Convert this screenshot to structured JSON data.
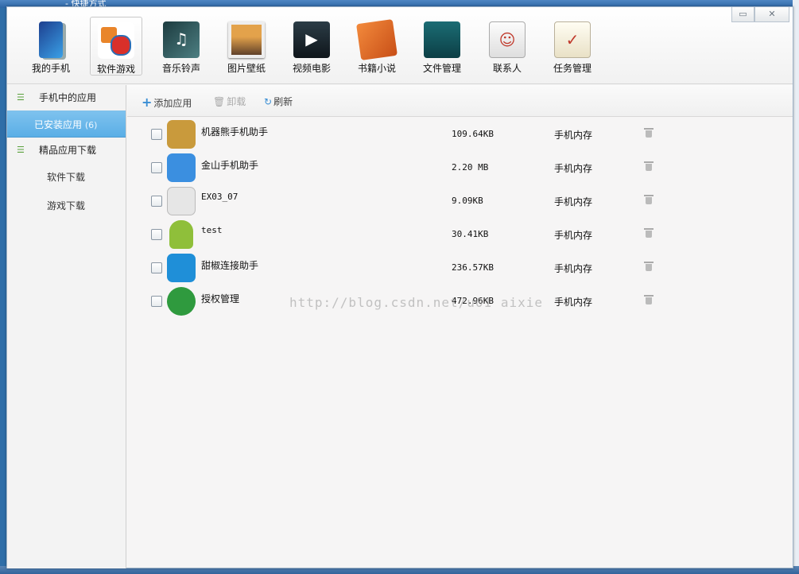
{
  "desktop": {
    "top_label": "- 快捷方式"
  },
  "window": {
    "minimize_glyph": "▭",
    "close_glyph": "✕"
  },
  "nav": [
    {
      "label": "我的手机",
      "icon": "phone-icon"
    },
    {
      "label": "软件游戏",
      "icon": "apps-games-icon",
      "active": true
    },
    {
      "label": "音乐铃声",
      "icon": "music-icon"
    },
    {
      "label": "图片壁纸",
      "icon": "photo-icon"
    },
    {
      "label": "视频电影",
      "icon": "video-icon"
    },
    {
      "label": "书籍小说",
      "icon": "book-icon"
    },
    {
      "label": "文件管理",
      "icon": "folder-icon"
    },
    {
      "label": "联系人",
      "icon": "contacts-icon"
    },
    {
      "label": "任务管理",
      "icon": "task-icon"
    }
  ],
  "sidebar": {
    "group1": "手机中的应用",
    "installed": "已安装应用",
    "installed_count": "(6)",
    "group2": "精品应用下载",
    "software": "软件下载",
    "games": "游戏下载"
  },
  "toolbar": {
    "add": "添加应用",
    "uninstall": "卸载",
    "refresh": "刷新"
  },
  "apps": [
    {
      "name": "机器熊手机助手",
      "size": "109.64KB",
      "location": "手机内存",
      "color": "#c99a3c"
    },
    {
      "name": "金山手机助手",
      "size": "2.20 MB",
      "location": "手机内存",
      "color": "#3b8fe0"
    },
    {
      "name": "EX03_07",
      "size": "9.09KB",
      "location": "手机内存",
      "color": "#e6e6e6"
    },
    {
      "name": "test",
      "size": "30.41KB",
      "location": "手机内存",
      "color": "#8fbf3a"
    },
    {
      "name": "甜椒连接助手",
      "size": "236.57KB",
      "location": "手机内存",
      "color": "#1f8fd8"
    },
    {
      "name": "授权管理",
      "size": "472.96KB",
      "location": "手机内存",
      "color": "#2f9a3e"
    }
  ],
  "watermark": "http://blog.csdn.net/u01 aixie"
}
